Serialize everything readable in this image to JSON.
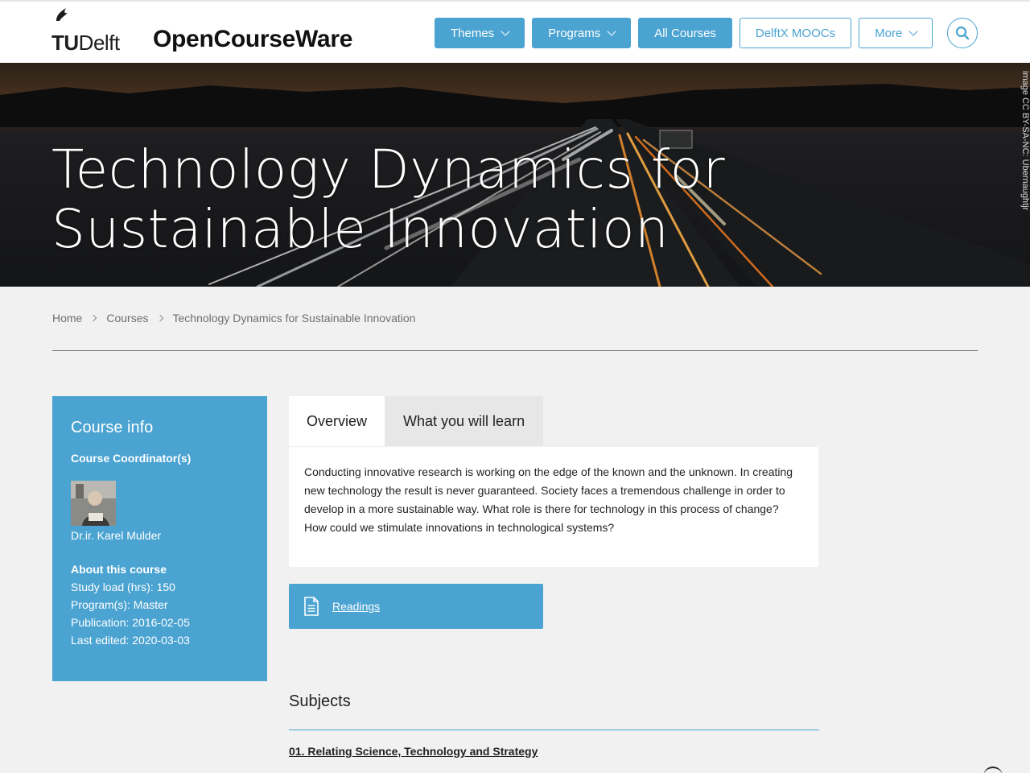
{
  "header": {
    "logo_text_tu": "TU",
    "logo_text_delft": "Delft",
    "site_title": "OpenCourseWare",
    "nav": [
      {
        "label": "Themes",
        "has_dropdown": true,
        "style": "filled"
      },
      {
        "label": "Programs",
        "has_dropdown": true,
        "style": "filled"
      },
      {
        "label": "All Courses",
        "has_dropdown": false,
        "style": "filled"
      },
      {
        "label": "DelftX MOOCs",
        "has_dropdown": false,
        "style": "outline"
      },
      {
        "label": "More",
        "has_dropdown": true,
        "style": "outline"
      }
    ],
    "search_icon": "search-icon"
  },
  "hero": {
    "title": "Technology Dynamics for Sustainable Innovation",
    "credit": "image CC BY-SA-NC: Ubernaughtjr"
  },
  "breadcrumb": [
    "Home",
    "Courses",
    "Technology Dynamics for Sustainable Innovation"
  ],
  "course_info": {
    "heading": "Course info",
    "coordinator_label": "Course Coordinator(s)",
    "coordinator_name": "Dr.ir. Karel Mulder",
    "about_label": "About this course",
    "study_load": "Study load (hrs): 150",
    "programs": "Program(s): Master",
    "publication": "Publication: 2016-02-05",
    "last_edited": "Last edited: 2020-03-03"
  },
  "tabs": [
    {
      "label": "Overview",
      "active": true
    },
    {
      "label": "What you will learn",
      "active": false
    }
  ],
  "overview_text": "Conducting innovative research is working on the edge of the known and the unknown. In creating new technology the result is never guaranteed. Society faces a tremendous challenge in order to develop in a more sustainable way. What role is there for technology in this process of change? How could we stimulate innovations in technological systems?",
  "readings": {
    "label": "Readings",
    "icon": "document-icon"
  },
  "subjects": {
    "heading": "Subjects",
    "items": [
      "01. Relating Science, Technology and Strategy"
    ]
  },
  "colors": {
    "accent": "#4aa3d1",
    "background": "#f1f1f1"
  }
}
